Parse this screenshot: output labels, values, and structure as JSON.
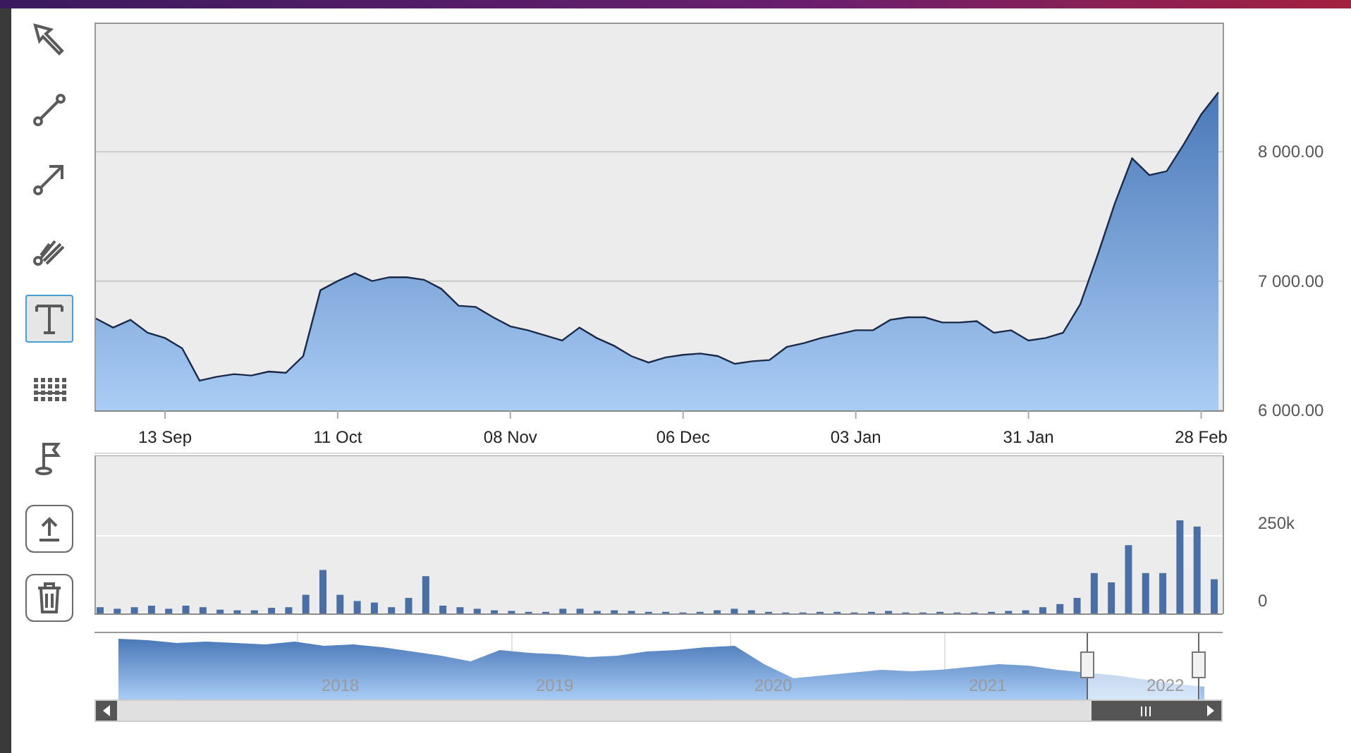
{
  "toolbar": {
    "tools": [
      {
        "kind": "pointer",
        "selected": false
      },
      {
        "kind": "line",
        "selected": false
      },
      {
        "kind": "arrow",
        "selected": false
      },
      {
        "kind": "parallel",
        "selected": false
      },
      {
        "kind": "text",
        "selected": true
      },
      {
        "kind": "grid",
        "selected": false
      },
      {
        "kind": "flag",
        "selected": false
      },
      {
        "kind": "export",
        "selected": false
      },
      {
        "kind": "delete",
        "selected": false
      }
    ]
  },
  "price_chart": {
    "chart_data": {
      "type": "area",
      "categories": [
        null,
        null,
        null,
        null,
        "13 Sep",
        null,
        null,
        null,
        null,
        null,
        null,
        null,
        null,
        null,
        "11 Oct",
        null,
        null,
        null,
        null,
        null,
        null,
        null,
        null,
        null,
        "08 Nov",
        null,
        null,
        null,
        null,
        null,
        null,
        null,
        null,
        null,
        "06 Dec",
        null,
        null,
        null,
        null,
        null,
        null,
        null,
        null,
        null,
        "03 Jan",
        null,
        null,
        null,
        null,
        null,
        null,
        null,
        null,
        null,
        "31 Jan",
        null,
        null,
        null,
        null,
        null,
        null,
        null,
        null,
        null,
        "28 Feb",
        null
      ],
      "series": [
        {
          "color": "#4a78b8",
          "values": [
            6710,
            6640,
            6700,
            6600,
            6560,
            6480,
            6230,
            6260,
            6280,
            6270,
            6300,
            6290,
            6420,
            6930,
            7000,
            7060,
            7000,
            7030,
            7030,
            7010,
            6940,
            6810,
            6800,
            6720,
            6650,
            6620,
            6580,
            6540,
            6640,
            6560,
            6500,
            6420,
            6370,
            6410,
            6430,
            6440,
            6420,
            6360,
            6380,
            6390,
            6490,
            6520,
            6560,
            6590,
            6620,
            6620,
            6700,
            6720,
            6720,
            6680,
            6680,
            6690,
            6600,
            6620,
            6540,
            6560,
            6600,
            6820,
            7200,
            7600,
            7950,
            7820,
            7850,
            8060,
            8290,
            8460
          ]
        }
      ],
      "ylim": [
        6000,
        9000
      ],
      "yticks": [
        {
          "value": 6000,
          "label": "6 000.00"
        },
        {
          "value": 7000,
          "label": "7 000.00"
        },
        {
          "value": 8000,
          "label": "8 000.00"
        }
      ]
    }
  },
  "volume_chart": {
    "chart_data": {
      "type": "bar",
      "categories": [
        null,
        null,
        null,
        null,
        null,
        null,
        null,
        null,
        null,
        null,
        null,
        null,
        null,
        null,
        null,
        null,
        null,
        null,
        null,
        null,
        null,
        null,
        null,
        null,
        null,
        null,
        null,
        null,
        null,
        null,
        null,
        null,
        null,
        null,
        null,
        null,
        null,
        null,
        null,
        null,
        null,
        null,
        null,
        null,
        null,
        null,
        null,
        null,
        null,
        null,
        null,
        null,
        null,
        null,
        null,
        null,
        null,
        null,
        null,
        null,
        null,
        null,
        null,
        null,
        null,
        null
      ],
      "series": [
        {
          "color": "#4a6fa5",
          "values": [
            20000,
            15000,
            20000,
            25000,
            15000,
            25000,
            20000,
            12000,
            10000,
            10000,
            18000,
            20000,
            60000,
            140000,
            60000,
            40000,
            35000,
            20000,
            50000,
            120000,
            25000,
            20000,
            15000,
            10000,
            8000,
            5000,
            5000,
            15000,
            15000,
            8000,
            10000,
            8000,
            5000,
            5000,
            3000,
            5000,
            10000,
            15000,
            10000,
            5000,
            3000,
            3000,
            5000,
            5000,
            3000,
            5000,
            8000,
            3000,
            3000,
            5000,
            3000,
            3000,
            5000,
            8000,
            10000,
            20000,
            30000,
            50000,
            130000,
            100000,
            220000,
            130000,
            130000,
            300000,
            280000,
            110000
          ]
        }
      ],
      "ylim": [
        0,
        500000
      ],
      "yticks": [
        {
          "value": 0,
          "label": "0"
        },
        {
          "value": 250000,
          "label": "250k"
        }
      ]
    }
  },
  "navigator": {
    "year_labels": [
      "2018",
      "2019",
      "2020",
      "2021",
      "2022"
    ]
  }
}
